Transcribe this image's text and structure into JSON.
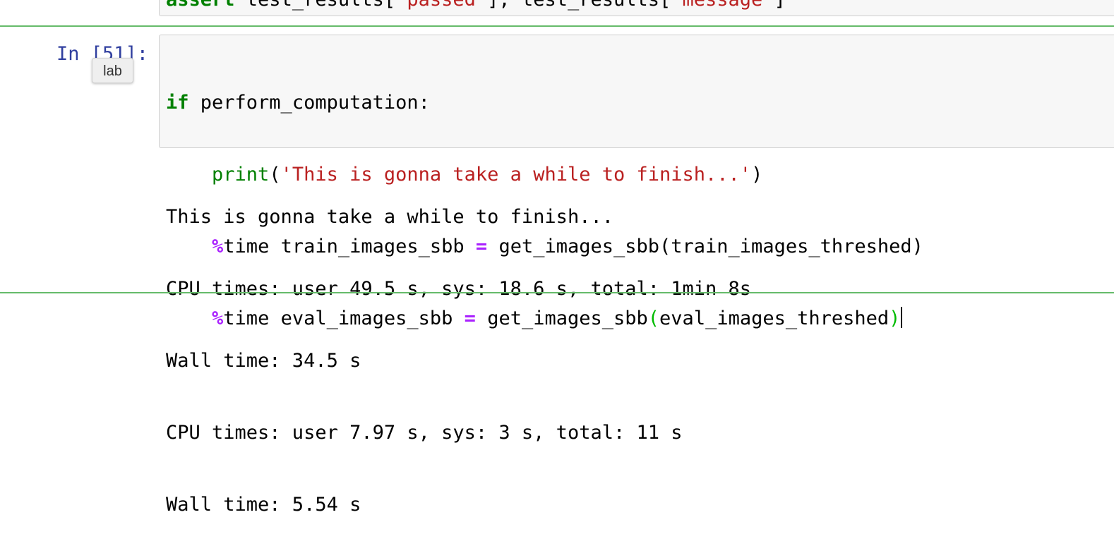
{
  "previous_cell": {
    "code_parts": [
      {
        "text": "assert ",
        "style": "kw"
      },
      {
        "text": "test_results[",
        "style": "plain"
      },
      {
        "text": "'passed'",
        "style": "str"
      },
      {
        "text": "], test_results[",
        "style": "plain"
      },
      {
        "text": "'message'",
        "style": "str"
      },
      {
        "text": "]",
        "style": "plain"
      }
    ]
  },
  "cell": {
    "prompt": "In [51]:",
    "tooltip": "lab",
    "code": {
      "line1": {
        "kw": "if",
        "rest": " perform_computation:"
      },
      "line2": {
        "indent": "    ",
        "func": "print",
        "open": "(",
        "str": "'This is gonna take a while to finish...'",
        "close": ")"
      },
      "line3": {
        "indent": "    ",
        "magic": "%",
        "a": "time train_images_sbb ",
        "op": "=",
        "b": " get_images_sbb(train_images_threshed)"
      },
      "line4": {
        "indent": "    ",
        "magic": "%",
        "a": "time eval_images_sbb ",
        "op": "=",
        "b": " get_images_sbb",
        "open": "(",
        "arg": "eval_images_threshed",
        "close": ")"
      }
    },
    "output": [
      "This is gonna take a while to finish...",
      "CPU times: user 49.5 s, sys: 18.6 s, total: 1min 8s",
      "Wall time: 34.5 s",
      "CPU times: user 7.97 s, sys: 3 s, total: 11 s",
      "Wall time: 5.54 s"
    ]
  },
  "colors": {
    "selected_cell_border": "#66bb6a",
    "prompt": "#303f9f",
    "keyword": "#008000",
    "string": "#ba2121",
    "operator": "#aa22ff",
    "bracket_match": "#00bb00"
  }
}
